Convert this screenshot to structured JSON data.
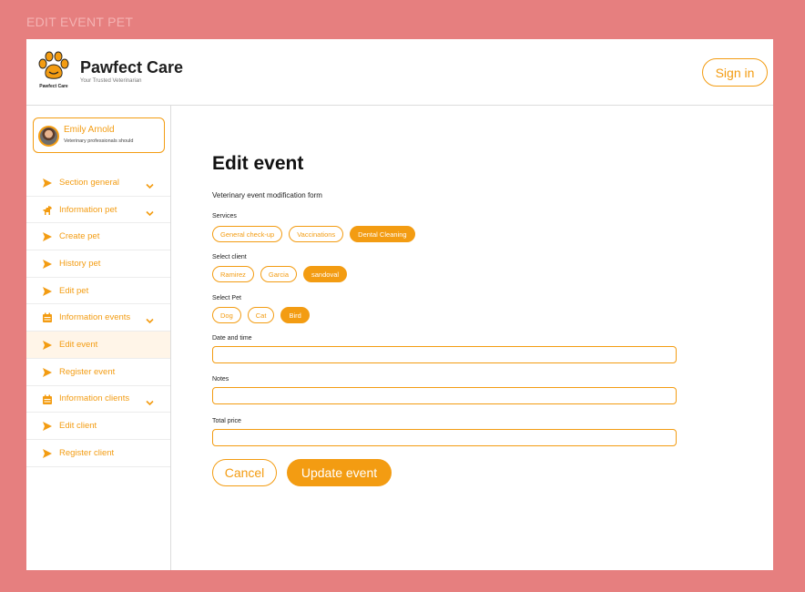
{
  "frame_title": "EDIT EVENT PET",
  "header": {
    "logo_caption": "Pawfect Care",
    "brand_name": "Pawfect Care",
    "brand_tagline": "Your Trusted Veterinarian",
    "signin_label": "Sign in"
  },
  "profile": {
    "name": "Emily Arnold",
    "subtitle": "Veterinary professionals should"
  },
  "sidebar": {
    "items": [
      {
        "label": "Section general",
        "icon": "send-arrow-icon",
        "chevron": true
      },
      {
        "label": "Information pet",
        "icon": "dog-icon",
        "chevron": true
      },
      {
        "label": "Create pet",
        "icon": "send-arrow-icon",
        "chevron": false
      },
      {
        "label": "History pet",
        "icon": "send-arrow-icon",
        "chevron": false
      },
      {
        "label": "Edit pet",
        "icon": "send-arrow-icon",
        "chevron": false
      },
      {
        "label": "Information events",
        "icon": "calendar-icon",
        "chevron": true
      },
      {
        "label": "Edit event",
        "icon": "send-arrow-icon",
        "chevron": false,
        "active": true
      },
      {
        "label": "Register event",
        "icon": "send-arrow-icon",
        "chevron": false
      },
      {
        "label": "Information clients",
        "icon": "calendar-icon",
        "chevron": true
      },
      {
        "label": "Edit client",
        "icon": "send-arrow-icon",
        "chevron": false
      },
      {
        "label": "Register client",
        "icon": "send-arrow-icon",
        "chevron": false
      }
    ]
  },
  "main": {
    "title": "Edit event",
    "subtitle": "Veterinary event modification form",
    "services": {
      "label": "Services",
      "options": [
        "General check-up",
        "Vaccinations",
        "Dental Cleaning"
      ],
      "selected": "Dental Cleaning"
    },
    "client": {
      "label": "Select client",
      "options": [
        "Ramirez",
        "Garcia",
        "sandoval"
      ],
      "selected": "sandoval"
    },
    "pet": {
      "label": "Select Pet",
      "options": [
        "Dog",
        "Cat",
        "Bird"
      ],
      "selected": "Bird"
    },
    "date_time": {
      "label": "Date and time",
      "value": ""
    },
    "notes": {
      "label": "Notes",
      "value": ""
    },
    "total_price": {
      "label": "Total price",
      "value": ""
    },
    "cancel_label": "Cancel",
    "update_label": "Update event"
  },
  "colors": {
    "background": "#e67f7f",
    "accent": "#f39c12",
    "active_item_bg": "#fff5e8"
  }
}
